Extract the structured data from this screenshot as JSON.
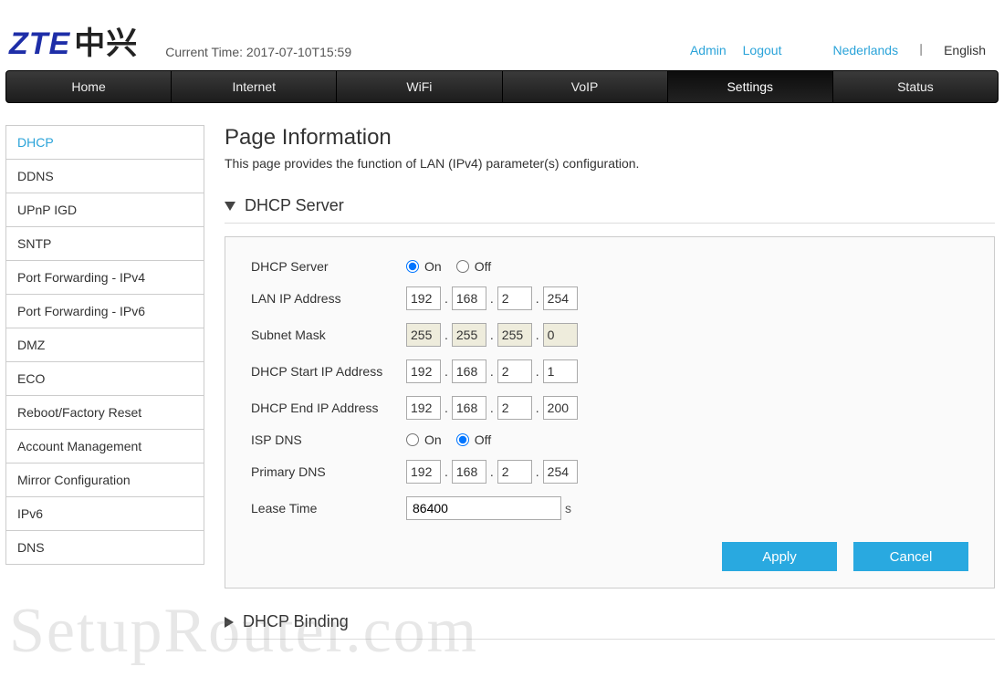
{
  "header": {
    "logo_west": "ZTE",
    "logo_cn": "中兴",
    "current_time_label": "Current Time:",
    "current_time_value": "2017-07-10T15:59",
    "links": {
      "admin": "Admin",
      "logout": "Logout",
      "lang_nl": "Nederlands",
      "lang_en": "English"
    }
  },
  "nav": {
    "items": [
      "Home",
      "Internet",
      "WiFi",
      "VoIP",
      "Settings",
      "Status"
    ],
    "active_index": 4
  },
  "sidebar": {
    "items": [
      "DHCP",
      "DDNS",
      "UPnP IGD",
      "SNTP",
      "Port Forwarding - IPv4",
      "Port Forwarding - IPv6",
      "DMZ",
      "ECO",
      "Reboot/Factory Reset",
      "Account Management",
      "Mirror Configuration",
      "IPv6",
      "DNS"
    ],
    "active_index": 0
  },
  "page": {
    "title": "Page Information",
    "desc": "This page provides the function of LAN (IPv4) parameter(s) configuration.",
    "section_dhcp_server": "DHCP Server",
    "section_dhcp_binding": "DHCP Binding"
  },
  "form": {
    "labels": {
      "dhcp_server": "DHCP Server",
      "on": "On",
      "off": "Off",
      "lan_ip": "LAN IP Address",
      "subnet": "Subnet Mask",
      "start_ip": "DHCP Start IP Address",
      "end_ip": "DHCP End IP Address",
      "isp_dns": "ISP DNS",
      "primary_dns": "Primary DNS",
      "lease": "Lease Time",
      "lease_unit": "s"
    },
    "dhcp_server_on": true,
    "isp_dns_on": false,
    "lan_ip": [
      "192",
      "168",
      "2",
      "254"
    ],
    "subnet": [
      "255",
      "255",
      "255",
      "0"
    ],
    "start_ip": [
      "192",
      "168",
      "2",
      "1"
    ],
    "end_ip": [
      "192",
      "168",
      "2",
      "200"
    ],
    "primary_dns": [
      "192",
      "168",
      "2",
      "254"
    ],
    "lease": "86400"
  },
  "buttons": {
    "apply": "Apply",
    "cancel": "Cancel"
  },
  "watermark": "SetupRouter.com"
}
